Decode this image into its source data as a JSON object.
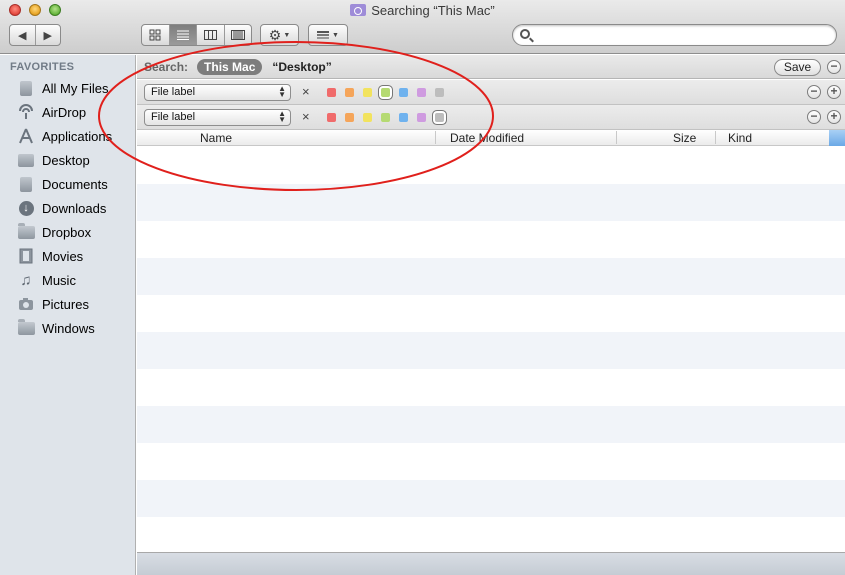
{
  "window": {
    "title": "Searching “This Mac”"
  },
  "toolbar": {
    "back_icon": "back-arrow-icon",
    "forward_icon": "forward-arrow-icon",
    "view_modes": [
      "icon-view",
      "list-view",
      "column-view",
      "coverflow-view"
    ],
    "active_view": "list-view",
    "search_placeholder": ""
  },
  "sidebar": {
    "heading": "FAVORITES",
    "items": [
      {
        "label": "All My Files",
        "icon": "all-files-icon"
      },
      {
        "label": "AirDrop",
        "icon": "airdrop-icon"
      },
      {
        "label": "Applications",
        "icon": "applications-icon"
      },
      {
        "label": "Desktop",
        "icon": "desktop-icon"
      },
      {
        "label": "Documents",
        "icon": "documents-icon"
      },
      {
        "label": "Downloads",
        "icon": "downloads-icon"
      },
      {
        "label": "Dropbox",
        "icon": "folder-icon"
      },
      {
        "label": "Movies",
        "icon": "movies-icon"
      },
      {
        "label": "Music",
        "icon": "music-icon"
      },
      {
        "label": "Pictures",
        "icon": "pictures-icon"
      },
      {
        "label": "Windows",
        "icon": "folder-icon"
      }
    ]
  },
  "scope": {
    "label": "Search:",
    "selected": "This Mac",
    "other": "“Desktop”",
    "save_label": "Save",
    "remove_symbol": "−",
    "add_symbol": "+"
  },
  "criteria": [
    {
      "attribute": "File label",
      "clear_symbol": "×",
      "selected_color": "green"
    },
    {
      "attribute": "File label",
      "clear_symbol": "×",
      "selected_color": "gray"
    }
  ],
  "label_colors": {
    "red": "#f06b6b",
    "orange": "#f5a55a",
    "yellow": "#f2e35e",
    "green": "#b5da72",
    "blue": "#6fb2ee",
    "purple": "#cf9be0",
    "gray": "#bdbdbd"
  },
  "columns": {
    "name": "Name",
    "date_modified": "Date Modified",
    "size": "Size",
    "kind": "Kind"
  },
  "annotation_color": "#e0201c"
}
